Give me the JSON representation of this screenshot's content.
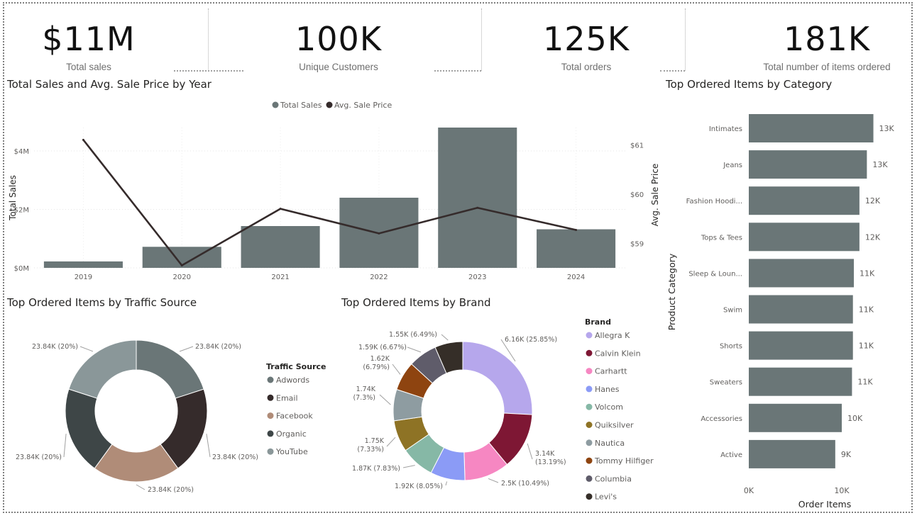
{
  "kpis": [
    {
      "value": "$11M",
      "label": "Total sales"
    },
    {
      "value": "100K",
      "label": "Unique Customers"
    },
    {
      "value": "125K",
      "label": "Total orders"
    },
    {
      "value": "181K",
      "label": "Total number of items ordered"
    }
  ],
  "colors": {
    "bar": "#6a7677",
    "line": "#352b2b",
    "frame": "#808080"
  },
  "chart_data": [
    {
      "type": "bar+line",
      "title": "Total Sales and Avg. Sale Price by Year",
      "categories": [
        "2019",
        "2020",
        "2021",
        "2022",
        "2023",
        "2024"
      ],
      "series": [
        {
          "name": "Total Sales",
          "type": "bar",
          "axis": "left",
          "color": "#6a7677",
          "values": [
            220000,
            720000,
            1430000,
            2400000,
            4800000,
            1320000
          ]
        },
        {
          "name": "Avg. Sale Price",
          "type": "line",
          "axis": "right",
          "color": "#352b2b",
          "values": [
            61.1,
            58.55,
            59.7,
            59.2,
            59.72,
            59.27
          ]
        }
      ],
      "ylabel": "Total Sales",
      "y2label": "Avg. Sale Price",
      "yticks": [
        "$0M",
        "$2M",
        "$4M"
      ],
      "y2ticks": [
        "$59",
        "$60",
        "$61"
      ],
      "ylim": [
        0,
        4800000
      ],
      "y2lim": [
        58.5,
        61.35
      ],
      "legend": "top-center",
      "grid": true
    },
    {
      "type": "bar",
      "orientation": "horizontal",
      "title": "Top Ordered Items by Category",
      "categories": [
        "Intimates",
        "Jeans",
        "Fashion Hoodi...",
        "Tops & Tees",
        "Sleep & Loun...",
        "Swim",
        "Shorts",
        "Sweaters",
        "Accessories",
        "Active"
      ],
      "values": [
        13400,
        12700,
        11900,
        11900,
        11300,
        11200,
        11200,
        11100,
        10000,
        9300
      ],
      "data_labels": [
        "13K",
        "13K",
        "12K",
        "12K",
        "11K",
        "11K",
        "11K",
        "11K",
        "10K",
        "9K"
      ],
      "xlabel": "Order Items",
      "ylabel": "Product Category",
      "xticks": [
        "0K",
        "10K"
      ],
      "xlim": [
        0,
        10000
      ],
      "color": "#6a7677"
    },
    {
      "type": "pie",
      "donut": true,
      "title": "Top Ordered Items by Traffic Source",
      "legend_title": "Traffic Source",
      "legend": "right",
      "slices": [
        {
          "name": "Adwords",
          "value": 23840,
          "label": "23.84K (20%)",
          "color": "#6a7677"
        },
        {
          "name": "Email",
          "value": 23840,
          "label": "23.84K (20%)",
          "color": "#352b2b"
        },
        {
          "name": "Facebook",
          "value": 23840,
          "label": "23.84K (20%)",
          "color": "#b08c78"
        },
        {
          "name": "Organic",
          "value": 23840,
          "label": "23.84K (20%)",
          "color": "#3e4647"
        },
        {
          "name": "YouTube",
          "value": 23840,
          "label": "23.84K (20%)",
          "color": "#8a9799"
        }
      ]
    },
    {
      "type": "pie",
      "donut": true,
      "title": "Top Ordered Items by Brand",
      "legend_title": "Brand",
      "legend": "right",
      "slices": [
        {
          "name": "Allegra K",
          "value": 6160,
          "label": "6.16K (25.85%)",
          "color": "#b6a7ec"
        },
        {
          "name": "Calvin Klein",
          "value": 3140,
          "label": "3.14K (13.19%)",
          "color": "#7e1734"
        },
        {
          "name": "Carhartt",
          "value": 2500,
          "label": "2.5K (10.49%)",
          "color": "#f687c2"
        },
        {
          "name": "Hanes",
          "value": 1920,
          "label": "1.92K (8.05%)",
          "color": "#8b9bf6"
        },
        {
          "name": "Volcom",
          "value": 1870,
          "label": "1.87K (7.83%)",
          "color": "#86b8a6"
        },
        {
          "name": "Quiksilver",
          "value": 1750,
          "label": "1.75K (7.33%)",
          "color": "#8e7325"
        },
        {
          "name": "Nautica",
          "value": 1740,
          "label": "1.74K (7.3%)",
          "color": "#8e9ca1"
        },
        {
          "name": "Tommy Hilfiger",
          "value": 1620,
          "label": "1.62K (6.79%)",
          "color": "#8e4410"
        },
        {
          "name": "Columbia",
          "value": 1590,
          "label": "1.59K (6.67%)",
          "color": "#5f5c6a"
        },
        {
          "name": "Levi's",
          "value": 1550,
          "label": "1.55K (6.49%)",
          "color": "#352e28"
        }
      ]
    }
  ]
}
